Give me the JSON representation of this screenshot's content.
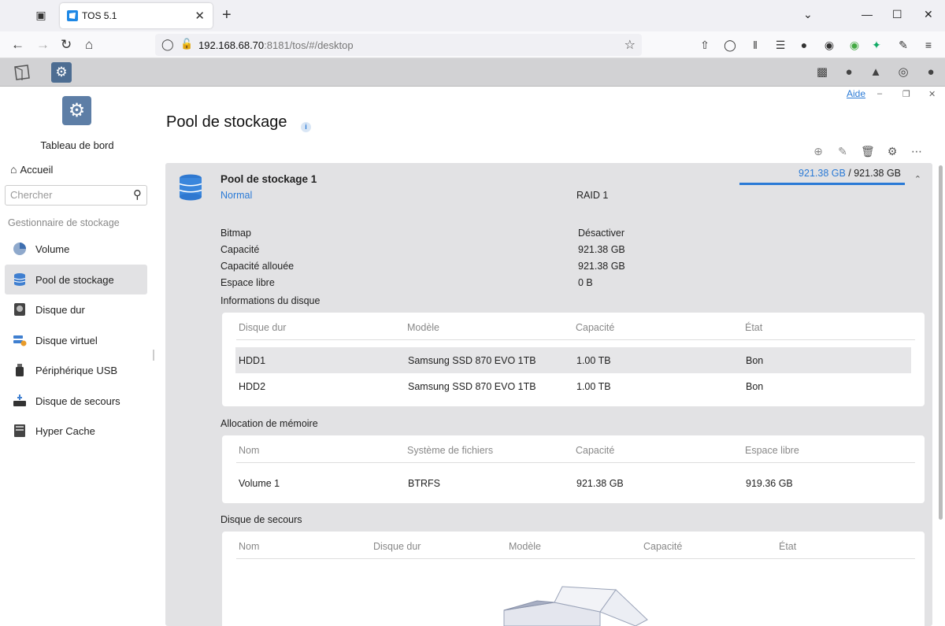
{
  "browser": {
    "tab_title": "TOS 5.1",
    "url_host": "192.168.68.70",
    "url_rest": ":8181/tos/#/desktop"
  },
  "window": {
    "help_label": "Aide"
  },
  "sidebar": {
    "dashboard_label": "Tableau de bord",
    "home_label": "Accueil",
    "search_placeholder": "Chercher",
    "section_title": "Gestionnaire de stockage",
    "items": [
      {
        "label": "Volume",
        "icon": "pie-icon"
      },
      {
        "label": "Pool de stockage",
        "icon": "database-icon"
      },
      {
        "label": "Disque dur",
        "icon": "hard-disk-icon"
      },
      {
        "label": "Disque virtuel",
        "icon": "virtual-disk-icon"
      },
      {
        "label": "Périphérique USB",
        "icon": "usb-icon"
      },
      {
        "label": "Disque de secours",
        "icon": "spare-disk-icon"
      },
      {
        "label": "Hyper Cache",
        "icon": "cache-icon"
      }
    ]
  },
  "main": {
    "title": "Pool de stockage",
    "pool": {
      "name": "Pool de stockage 1",
      "status": "Normal",
      "raid": "RAID 1",
      "used": "921.38 GB",
      "separator": " / ",
      "total": "921.38 GB",
      "used_fraction": 1.0,
      "details": [
        {
          "key": "Bitmap",
          "value": "Désactiver"
        },
        {
          "key": "Capacité",
          "value": "921.38 GB"
        },
        {
          "key": "Capacité allouée",
          "value": "921.38 GB"
        },
        {
          "key": "Espace libre",
          "value": "0 B"
        }
      ],
      "disk_info": {
        "title": "Informations du disque",
        "headers": [
          "Disque dur",
          "Modèle",
          "Capacité",
          "État"
        ],
        "rows": [
          [
            "HDD1",
            "Samsung SSD 870 EVO 1TB",
            "1.00 TB",
            "Bon"
          ],
          [
            "HDD2",
            "Samsung SSD 870 EVO 1TB",
            "1.00 TB",
            "Bon"
          ]
        ]
      },
      "allocation": {
        "title": "Allocation de mémoire",
        "headers": [
          "Nom",
          "Système de fichiers",
          "Capacité",
          "Espace libre"
        ],
        "rows": [
          [
            "Volume 1",
            "BTRFS",
            "921.38 GB",
            "919.36 GB"
          ]
        ]
      },
      "spare": {
        "title": "Disque de secours",
        "headers": [
          "Nom",
          "Disque dur",
          "Modèle",
          "Capacité",
          "État"
        ]
      }
    }
  },
  "colors": {
    "accent": "#2a7ad6",
    "panel": "#e2e2e4",
    "app_icon": "#5d7ea6"
  }
}
